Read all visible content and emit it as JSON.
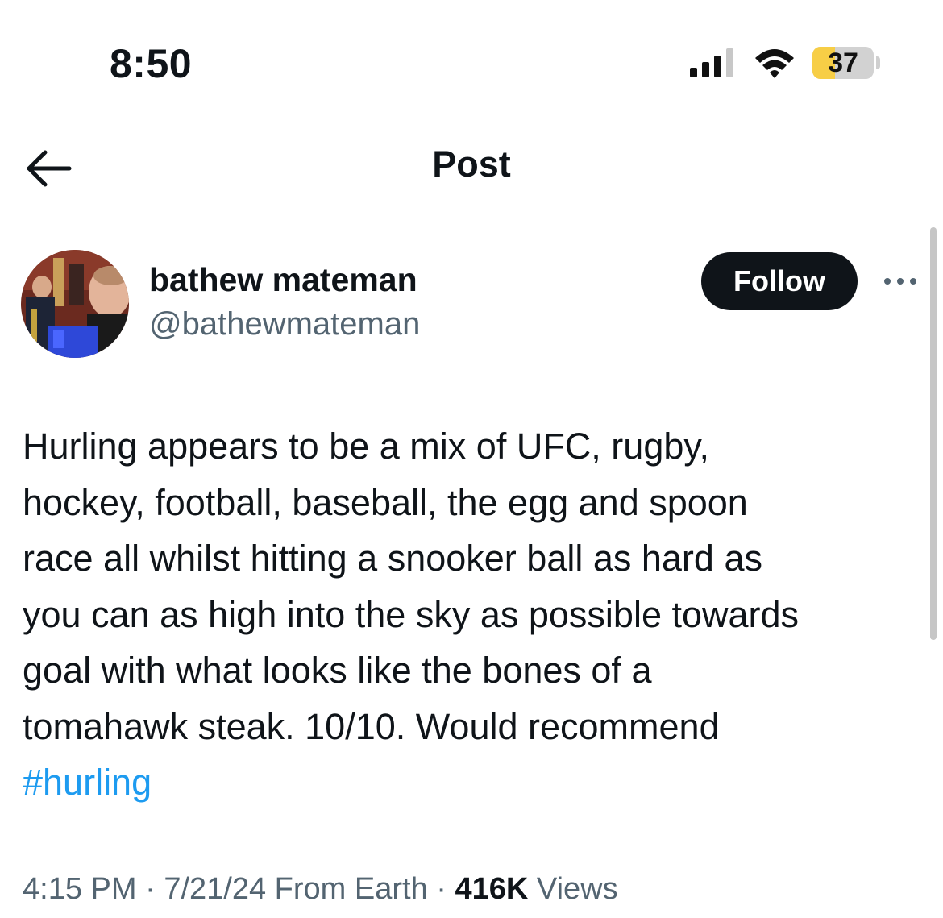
{
  "status_bar": {
    "time": "8:50",
    "battery_level": "37",
    "battery_fraction": 0.37,
    "icons": [
      "signal-icon",
      "wifi-icon",
      "battery-icon"
    ]
  },
  "nav": {
    "title": "Post",
    "back_icon": "back-arrow-icon"
  },
  "author": {
    "display_name": "bathew mateman",
    "handle": "@bathewmateman",
    "follow_label": "Follow",
    "more_icon": "more-icon"
  },
  "tweet": {
    "lines": [
      "Hurling appears to be a mix of UFC, rugby,",
      "hockey, football, baseball, the egg and spoon",
      "race all whilst hitting a snooker ball as hard as",
      "you can as high into the sky as possible towards",
      "goal with what looks like the bones of a",
      "tomahawk steak. 10/10. Would recommend"
    ],
    "hashtag": "#hurling"
  },
  "meta": {
    "time": "4:15 PM",
    "separator": "·",
    "date": "7/21/24",
    "location": "From Earth",
    "views_count": "416K",
    "views_label": "Views"
  },
  "colors": {
    "text": "#0f1419",
    "secondary": "#536471",
    "link": "#1d9bf0",
    "battery": "#f7ce46",
    "follow_bg": "#0f1419"
  }
}
